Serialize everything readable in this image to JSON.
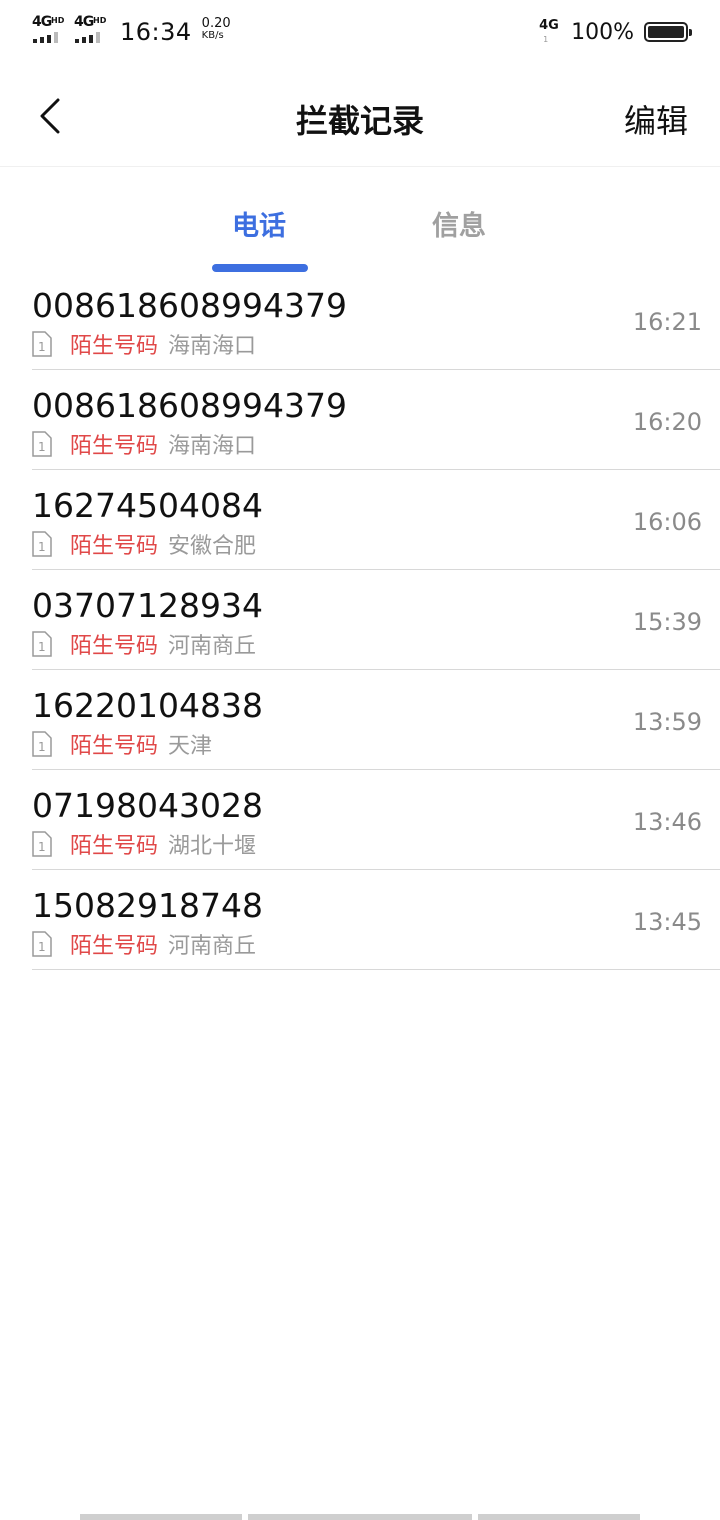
{
  "status_bar": {
    "net1": "4G",
    "net1_hd": "HD",
    "net2": "4G",
    "net2_hd": "HD",
    "time": "16:34",
    "speed_value": "0.20",
    "speed_unit": "KB/s",
    "right_net": "4G",
    "right_net_sub": "1",
    "battery_pct": "100%"
  },
  "header": {
    "title": "拦截记录",
    "edit_label": "编辑"
  },
  "tabs": [
    {
      "label": "电话",
      "active": true
    },
    {
      "label": "信息",
      "active": false
    }
  ],
  "records": [
    {
      "number": "008618608994379",
      "tag": "陌生号码",
      "location": "海南海口",
      "time": "16:21"
    },
    {
      "number": "008618608994379",
      "tag": "陌生号码",
      "location": "海南海口",
      "time": "16:20"
    },
    {
      "number": "16274504084",
      "tag": "陌生号码",
      "location": "安徽合肥",
      "time": "16:06"
    },
    {
      "number": "03707128934",
      "tag": "陌生号码",
      "location": "河南商丘",
      "time": "15:39"
    },
    {
      "number": "16220104838",
      "tag": "陌生号码",
      "location": "天津",
      "time": "13:59"
    },
    {
      "number": "07198043028",
      "tag": "陌生号码",
      "location": "湖北十堰",
      "time": "13:46"
    },
    {
      "number": "15082918748",
      "tag": "陌生号码",
      "location": "河南商丘",
      "time": "13:45"
    }
  ],
  "colors": {
    "accent": "#3d6fe0",
    "tag_red": "#e04848",
    "muted": "#9a9a9a"
  }
}
